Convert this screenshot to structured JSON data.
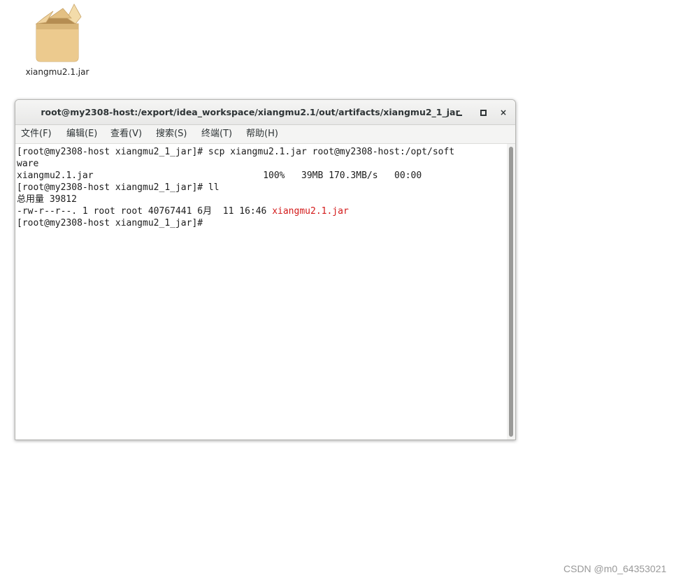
{
  "desktop": {
    "icon_name": "package-box-icon",
    "icon_label": "xiangmu2.1.jar"
  },
  "window": {
    "title": "root@my2308-host:/export/idea_workspace/xiangmu2.1/out/artifacts/xiangmu2_1_jar",
    "close_glyph": "×"
  },
  "menu": [
    {
      "label": "文件(F)"
    },
    {
      "label": "编辑(E)"
    },
    {
      "label": "查看(V)"
    },
    {
      "label": "搜索(S)"
    },
    {
      "label": "终端(T)"
    },
    {
      "label": "帮助(H)"
    }
  ],
  "terminal": {
    "lines": [
      "[root@my2308-host xiangmu2_1_jar]# scp xiangmu2.1.jar root@my2308-host:/opt/soft",
      "ware",
      "xiangmu2.1.jar                               100%   39MB 170.3MB/s   00:00",
      "[root@my2308-host xiangmu2_1_jar]# ll",
      "总用量 39812",
      "-rw-r--r--. 1 root root 40767441 6月  11 16:46 ",
      "[root@my2308-host xiangmu2_1_jar]# "
    ],
    "highlighted_file": "xiangmu2.1.jar",
    "highlight_color": "#d31a1a"
  },
  "watermark": "CSDN @m0_64353021"
}
